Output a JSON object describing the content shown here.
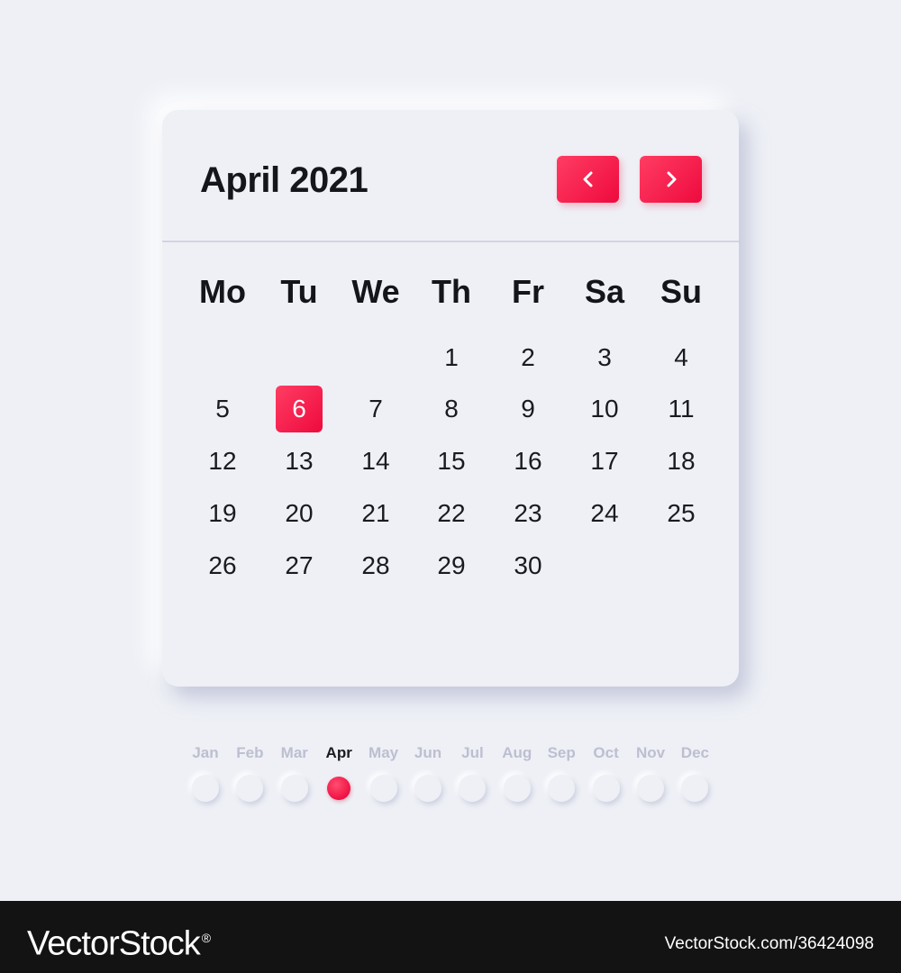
{
  "calendar": {
    "title": "April 2021",
    "prev_icon": "chevron-left-icon",
    "next_icon": "chevron-right-icon",
    "accent_color": "#f3174a",
    "weekdays": [
      "Mo",
      "Tu",
      "We",
      "Th",
      "Fr",
      "Sa",
      "Su"
    ],
    "first_weekday_index": 3,
    "days_in_month": 30,
    "selected_day": 6
  },
  "month_selector": {
    "months": [
      "Jan",
      "Feb",
      "Mar",
      "Apr",
      "May",
      "Jun",
      "Jul",
      "Aug",
      "Sep",
      "Oct",
      "Nov",
      "Dec"
    ],
    "active_index": 3
  },
  "watermark": {
    "brand": "VectorStock",
    "registered": "®",
    "code": "VectorStock.com/36424098"
  }
}
